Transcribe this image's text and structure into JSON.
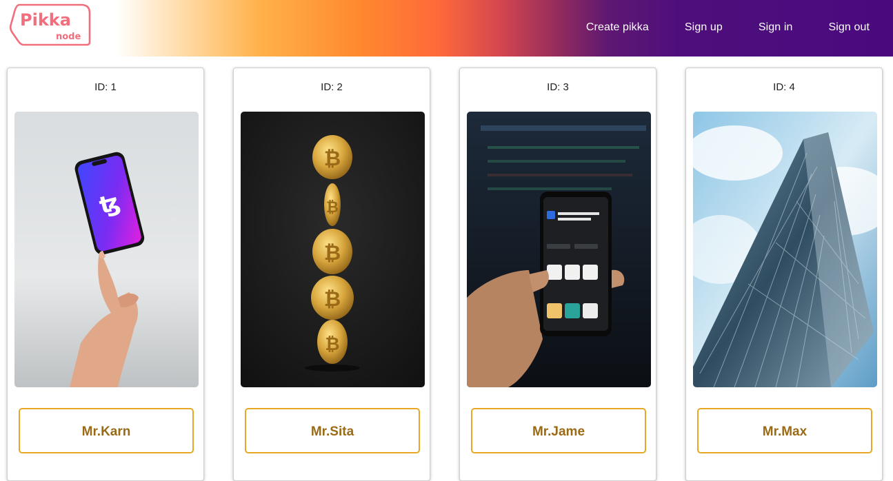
{
  "brand": {
    "name": "Pikka",
    "sub": "node",
    "color": "#f16e7c"
  },
  "nav": {
    "items": [
      {
        "label": "Create pikka"
      },
      {
        "label": "Sign up"
      },
      {
        "label": "Sign in"
      },
      {
        "label": "Sign out"
      }
    ]
  },
  "cards": [
    {
      "id_text": "ID: 1",
      "name": "Mr.Karn",
      "image": "hand-balancing-phone-with-tezos-logo"
    },
    {
      "id_text": "ID: 2",
      "name": "Mr.Sita",
      "image": "stacked-gold-bitcoins"
    },
    {
      "id_text": "ID: 3",
      "name": "Mr.Jame",
      "image": "hand-holding-phone-coinmarketcap-app"
    },
    {
      "id_text": "ID: 4",
      "name": "Mr.Max",
      "image": "glass-skyscraper-looking-up"
    }
  ],
  "colors": {
    "accent_border": "#e8a625",
    "name_text": "#9a6a14",
    "nav_text": "#ffffff"
  }
}
